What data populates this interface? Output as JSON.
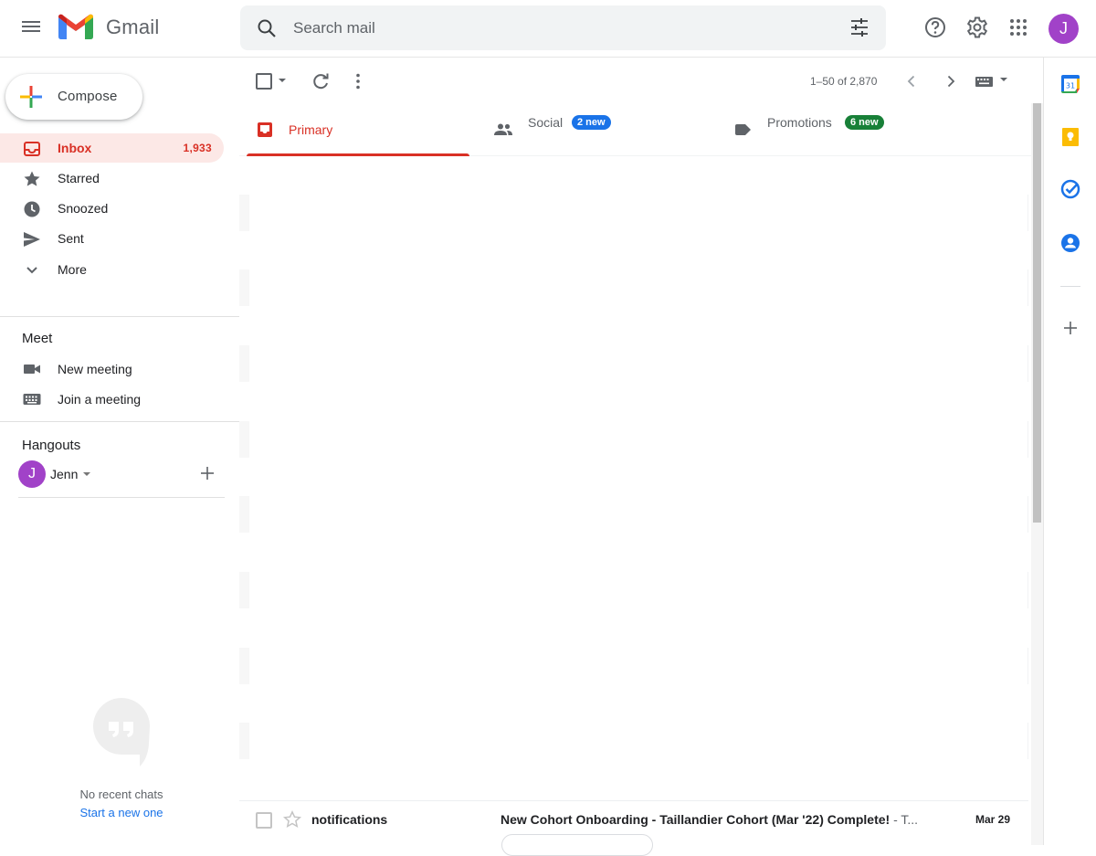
{
  "app": {
    "name": "Gmail"
  },
  "search": {
    "placeholder": "Search mail"
  },
  "user": {
    "initial": "J"
  },
  "compose": {
    "label": "Compose"
  },
  "nav": [
    {
      "label": "Inbox",
      "count": "1,933",
      "active": true
    },
    {
      "label": "Starred"
    },
    {
      "label": "Snoozed"
    },
    {
      "label": "Sent"
    },
    {
      "label": "More"
    }
  ],
  "meet": {
    "title": "Meet",
    "items": [
      {
        "label": "New meeting"
      },
      {
        "label": "Join a meeting"
      }
    ]
  },
  "hangouts": {
    "title": "Hangouts",
    "user": {
      "initial": "J",
      "name": "Jenn"
    },
    "no_chats": "No recent chats",
    "start_new": "Start a new one"
  },
  "toolbar": {
    "pager": "1–50 of 2,870"
  },
  "tabs": [
    {
      "label": "Primary",
      "active": true
    },
    {
      "label": "Social",
      "badge": "2 new",
      "badge_color": "#1a73e8"
    },
    {
      "label": "Promotions",
      "badge": "6 new",
      "badge_color": "#188038"
    }
  ],
  "emails": [
    {
      "sender": "notifications",
      "subject": "New Cohort Onboarding - Taillandier Cohort (Mar '22) Complete!",
      "snippet": " - T...",
      "date": "Mar 29"
    }
  ],
  "colors": {
    "accent": "#d93025",
    "avatar": "#a142c8",
    "link": "#1a73e8"
  }
}
